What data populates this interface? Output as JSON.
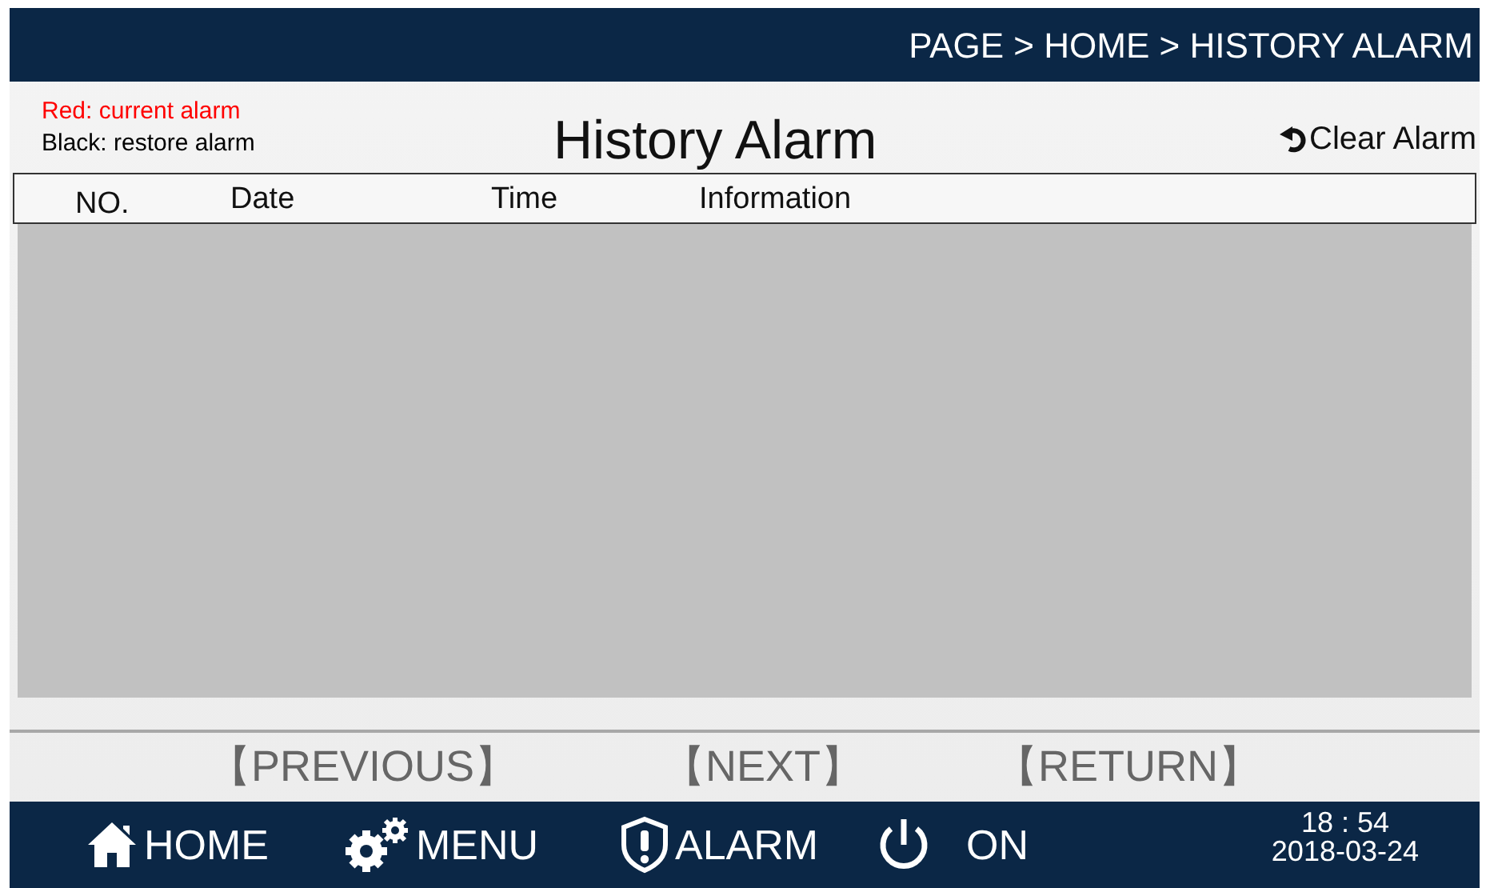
{
  "breadcrumb": "PAGE > HOME > HISTORY ALARM",
  "legend": [
    {
      "text": "Red: current alarm",
      "color": "#ff0000"
    },
    {
      "text": "Black: restore alarm",
      "color": "#000000"
    }
  ],
  "title": "History Alarm",
  "clear_button": {
    "label": "Clear Alarm"
  },
  "table": {
    "columns": [
      "NO.",
      "Date",
      "Time",
      "Information"
    ]
  },
  "pager": [
    "【PREVIOUS】",
    "【NEXT】",
    "【RETURN】"
  ],
  "nav": [
    {
      "kind": "home",
      "label": "HOME"
    },
    {
      "kind": "menu",
      "label": "MENU"
    },
    {
      "kind": "alarm",
      "label": "ALARM"
    },
    {
      "kind": "power",
      "label": "ON"
    }
  ],
  "clock": {
    "time": "18 : 54",
    "date": "2018-03-24"
  }
}
